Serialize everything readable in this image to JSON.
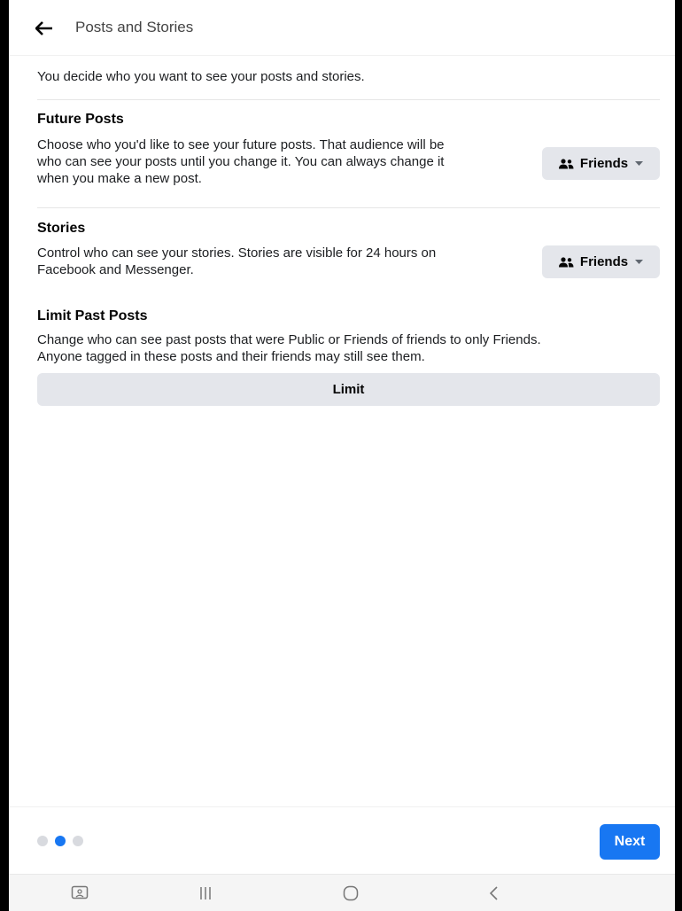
{
  "header": {
    "title": "Posts and Stories"
  },
  "intro": "You decide who you want to see your posts and stories.",
  "sections": {
    "future_posts": {
      "title": "Future Posts",
      "description": [
        "Choose who you'd like to see your future posts. That audience will be",
        "who can see your posts until you change it. You can always change it",
        "when you make a new post."
      ],
      "audience": "Friends"
    },
    "stories": {
      "title": "Stories",
      "description": [
        "Control who can see your stories. Stories are visible for 24 hours on",
        "Facebook and Messenger."
      ],
      "audience": "Friends"
    },
    "limit_past_posts": {
      "title": "Limit Past Posts",
      "description": [
        "Change who can see past posts that were Public or Friends of friends to only Friends.",
        "Anyone tagged in these posts and their friends may still see them."
      ],
      "button": "Limit"
    }
  },
  "footer": {
    "progress": {
      "total_steps": 3,
      "current_step": 2
    },
    "next_label": "Next"
  },
  "colors": {
    "accent": "#1877f2",
    "button_bg": "#e4e6eb",
    "dot_inactive": "#d8dadf"
  },
  "icons": [
    "back-arrow-icon",
    "friends-icon",
    "caret-down-icon",
    "screenshot-icon",
    "recent-apps-icon",
    "home-icon",
    "back-chevron-icon"
  ]
}
